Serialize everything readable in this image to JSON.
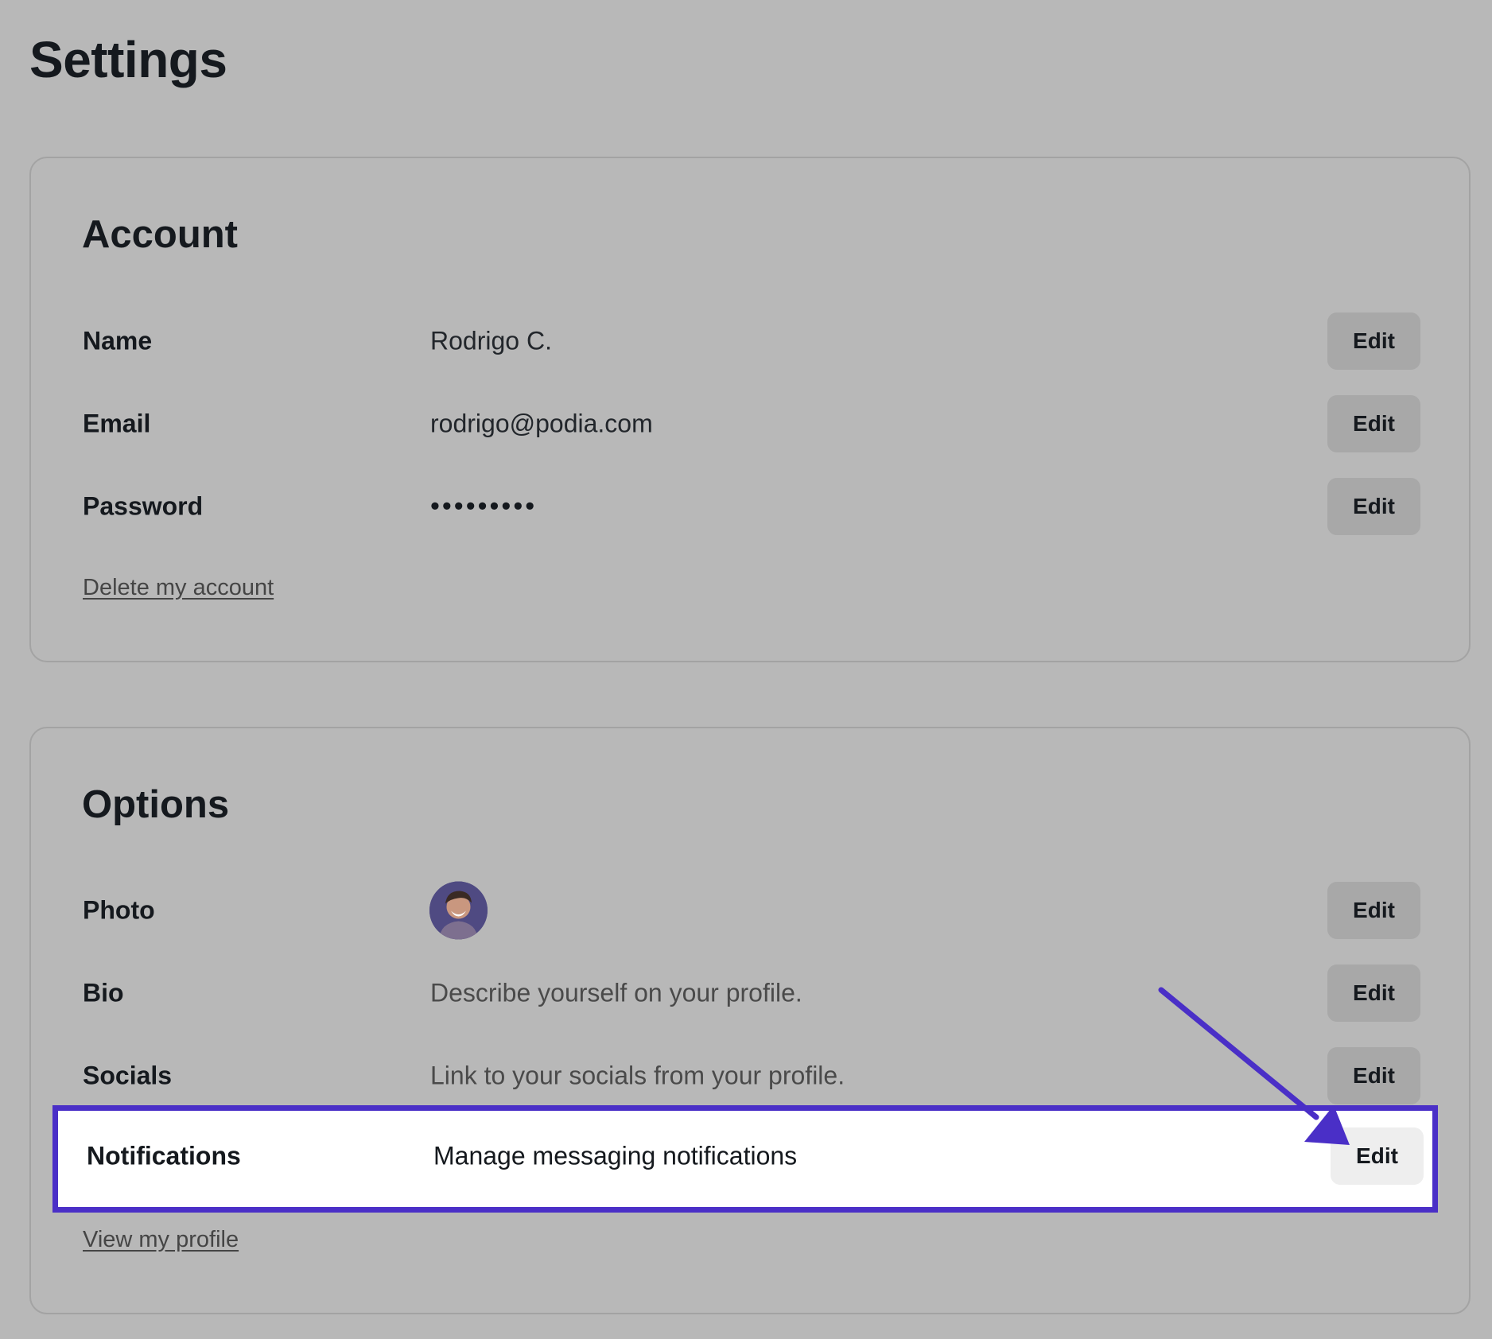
{
  "page": {
    "title": "Settings"
  },
  "account": {
    "title": "Account",
    "rows": [
      {
        "label": "Name",
        "value": "Rodrigo C.",
        "button": "Edit"
      },
      {
        "label": "Email",
        "value": "rodrigo@podia.com",
        "button": "Edit"
      },
      {
        "label": "Password",
        "value": "•••••••••",
        "button": "Edit"
      }
    ],
    "link": "Delete my account"
  },
  "options": {
    "title": "Options",
    "rows": [
      {
        "label": "Photo",
        "button": "Edit"
      },
      {
        "label": "Bio",
        "value": "Describe yourself on your profile.",
        "button": "Edit"
      },
      {
        "label": "Socials",
        "value": "Link to your socials from your profile.",
        "button": "Edit"
      },
      {
        "label": "Notifications",
        "value": "Manage messaging notifications",
        "button": "Edit"
      }
    ],
    "link": "View my profile"
  },
  "annotation": {
    "highlight_color": "#4a2fc7",
    "arrow_icon": "arrow-down-right-icon"
  },
  "colors": {
    "background": "#b8b8b8",
    "card_border": "#a3a3a3",
    "button_bg": "#a8a8a8",
    "highlight_bg": "#ffffff"
  }
}
